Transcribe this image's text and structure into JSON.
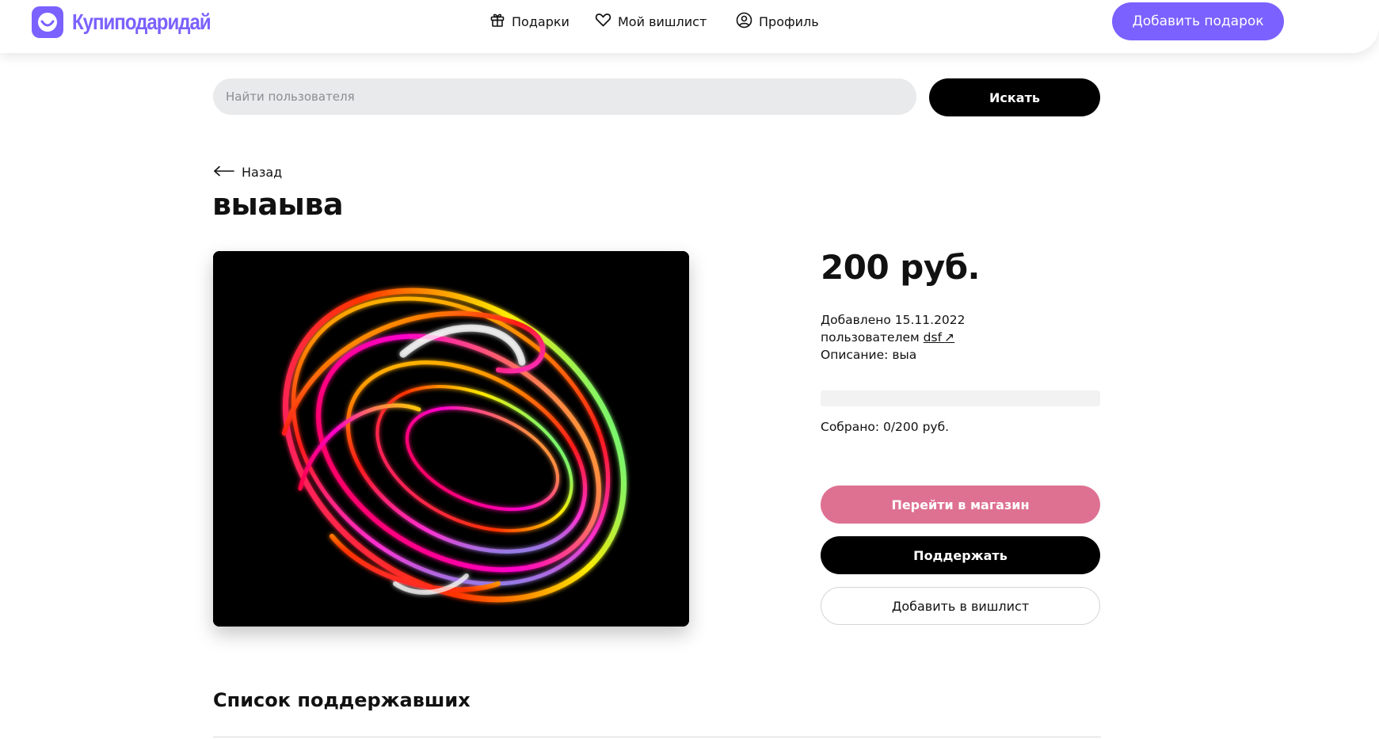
{
  "app": {
    "logo_text": "Купиподаридай",
    "brand_color": "#7b61ff"
  },
  "nav": {
    "items": [
      {
        "label": "Подарки",
        "icon": "gift-icon"
      },
      {
        "label": "Мой вишлист",
        "icon": "heart-icon"
      },
      {
        "label": "Профиль",
        "icon": "user-circle-icon"
      }
    ],
    "add_gift_label": "Добавить подарок"
  },
  "search": {
    "placeholder": "Найти пользователя",
    "value": "",
    "button_label": "Искать"
  },
  "back": {
    "label": "Назад",
    "icon": "arrow-left-icon"
  },
  "gift": {
    "title": "выаыва",
    "price": "200 руб.",
    "added_text": "Добавлено 15.11.2022",
    "by_label": "пользователем",
    "author": "dsf",
    "author_link_icon": "↗",
    "description": "Описание: выа",
    "progress_fraction": 0,
    "collected_text": "Собрано: 0/200 руб."
  },
  "actions": {
    "shop_label": "Перейти в магазин",
    "support_label": "Поддержать",
    "wishlist_label": "Добавить в вишлист",
    "shop_color": "#de7191"
  },
  "supporters": {
    "title": "Список поддержавших"
  }
}
